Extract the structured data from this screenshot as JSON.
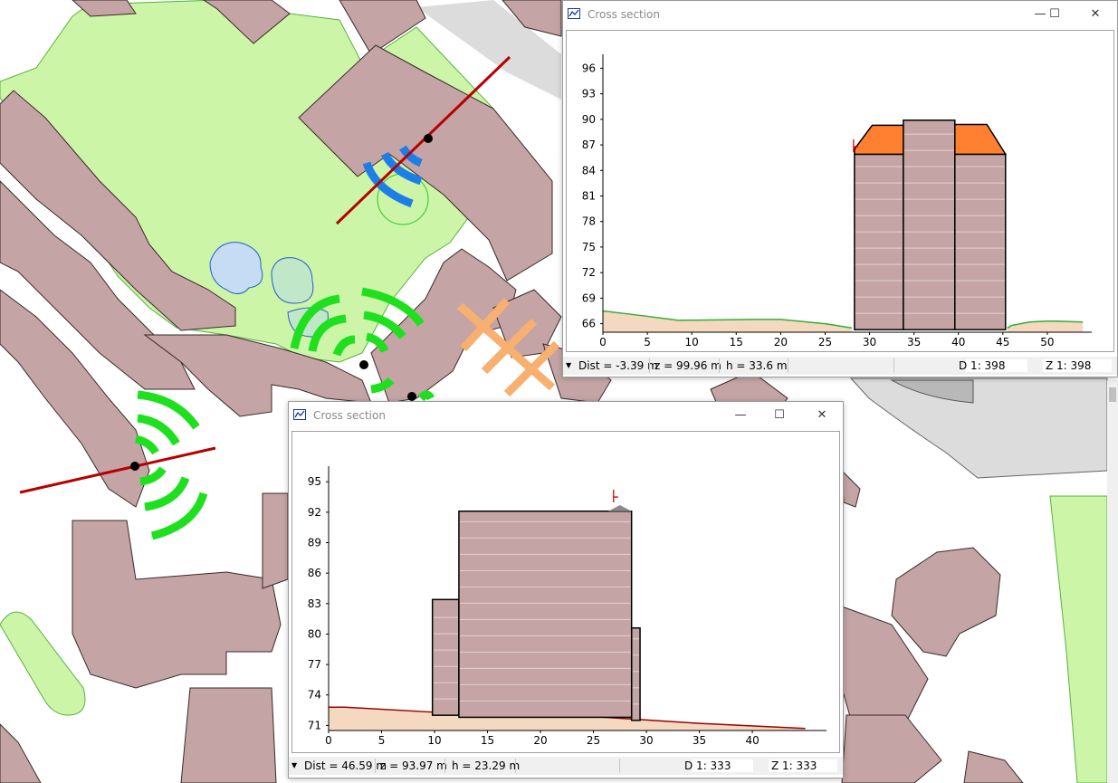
{
  "map": {
    "colors": {
      "background": "#ffffff",
      "building": "#c4a4a4",
      "building_outline": "#3a2a2a",
      "park": "#ccf5a8",
      "park_outline": "#58b040",
      "water": "#c6dcf4",
      "water_outline": "#2a5ad0",
      "pavement": "#dcdcdc",
      "section_line": "#b80000",
      "wave_green": "#1ee01e",
      "wave_blue": "#1e7ee8",
      "orange_marker": "#f8b070"
    }
  },
  "windows": [
    {
      "id": "top",
      "title": "Cross section",
      "controls": {
        "minimize": "—",
        "maximize": "☐",
        "close": "✕"
      },
      "chart_data": {
        "type": "area",
        "x_ticks": [
          0,
          5,
          10,
          15,
          20,
          25,
          30,
          35,
          40,
          45,
          50
        ],
        "y_ticks": [
          66,
          69,
          72,
          75,
          78,
          81,
          84,
          87,
          90,
          93,
          96
        ],
        "xlim": [
          0,
          55
        ],
        "ylim": [
          65,
          97
        ],
        "terrain": {
          "x": [
            0,
            4,
            8.5,
            17,
            20,
            25,
            28
          ],
          "y": [
            67.5,
            67,
            66.4,
            66.5,
            66.5,
            66,
            65.5
          ]
        },
        "terrain_right": {
          "x": [
            45.5,
            46,
            48,
            50,
            51,
            54
          ],
          "y": [
            65.5,
            65.8,
            66.2,
            66.3,
            66.3,
            66.2
          ]
        },
        "gap_ground": {
          "x": [
            33.8,
            35,
            39,
            40.5
          ],
          "y": [
            65.3,
            66.2,
            66.2,
            65.3
          ]
        },
        "buildings": [
          {
            "x0": 28.3,
            "x1": 33.8,
            "base": 65.3,
            "top": 85.9
          },
          {
            "x0": 33.8,
            "x1": 39.6,
            "base": 65.3,
            "top": 89.9
          },
          {
            "x0": 39.6,
            "x1": 45.3,
            "base": 65.3,
            "top": 85.9
          }
        ],
        "roofs": [
          {
            "points": [
              [
                28.3,
                85.9
              ],
              [
                28.3,
                86.5
              ],
              [
                30.3,
                89.3
              ],
              [
                33.8,
                89.3
              ],
              [
                33.8,
                85.9
              ]
            ]
          },
          {
            "points": [
              [
                39.6,
                85.9
              ],
              [
                39.6,
                89.4
              ],
              [
                43.2,
                89.4
              ],
              [
                45.3,
                85.9
              ]
            ]
          }
        ],
        "marker": {
          "x": 28.2,
          "y": 86.8
        }
      },
      "status": {
        "dist": "Dist = -3.39 m",
        "z": "z = 99.96 m",
        "h": "h = 33.6 m",
        "d_scale": "D  1: 398",
        "z_scale": "Z  1: 398"
      }
    },
    {
      "id": "bottom",
      "title": "Cross section",
      "controls": {
        "minimize": "—",
        "maximize": "☐",
        "close": "✕"
      },
      "chart_data": {
        "type": "area",
        "x_ticks": [
          0,
          5,
          10,
          15,
          20,
          25,
          30,
          35,
          40
        ],
        "y_ticks": [
          71,
          74,
          77,
          80,
          83,
          86,
          89,
          92,
          95
        ],
        "xlim": [
          0,
          47
        ],
        "ylim": [
          70.5,
          96
        ],
        "terrain": {
          "x": [
            0,
            1.5,
            10,
            20,
            26,
            35,
            45
          ],
          "y": [
            72.8,
            72.8,
            72.3,
            72.1,
            71.8,
            71.2,
            70.7
          ]
        },
        "buildings": [
          {
            "x0": 9.8,
            "x1": 12.3,
            "base": 72,
            "top": 83.4
          },
          {
            "x0": 28.6,
            "x1": 29.4,
            "base": 71.5,
            "top": 80.6
          },
          {
            "x0": 12.3,
            "x1": 28.6,
            "base": 71.8,
            "top": 92.1
          }
        ],
        "roof_cap": {
          "x": [
            26.4,
            27.5,
            28.6
          ],
          "y": [
            92.1,
            92.7,
            92.1
          ]
        },
        "marker": {
          "x": 26.9,
          "y": 93.5
        }
      },
      "status": {
        "dist": "Dist = 46.59 m",
        "z": "z = 93.97 m",
        "h": "h = 23.29 m",
        "d_scale": "D  1: 333",
        "z_scale": "Z  1: 333"
      }
    }
  ]
}
